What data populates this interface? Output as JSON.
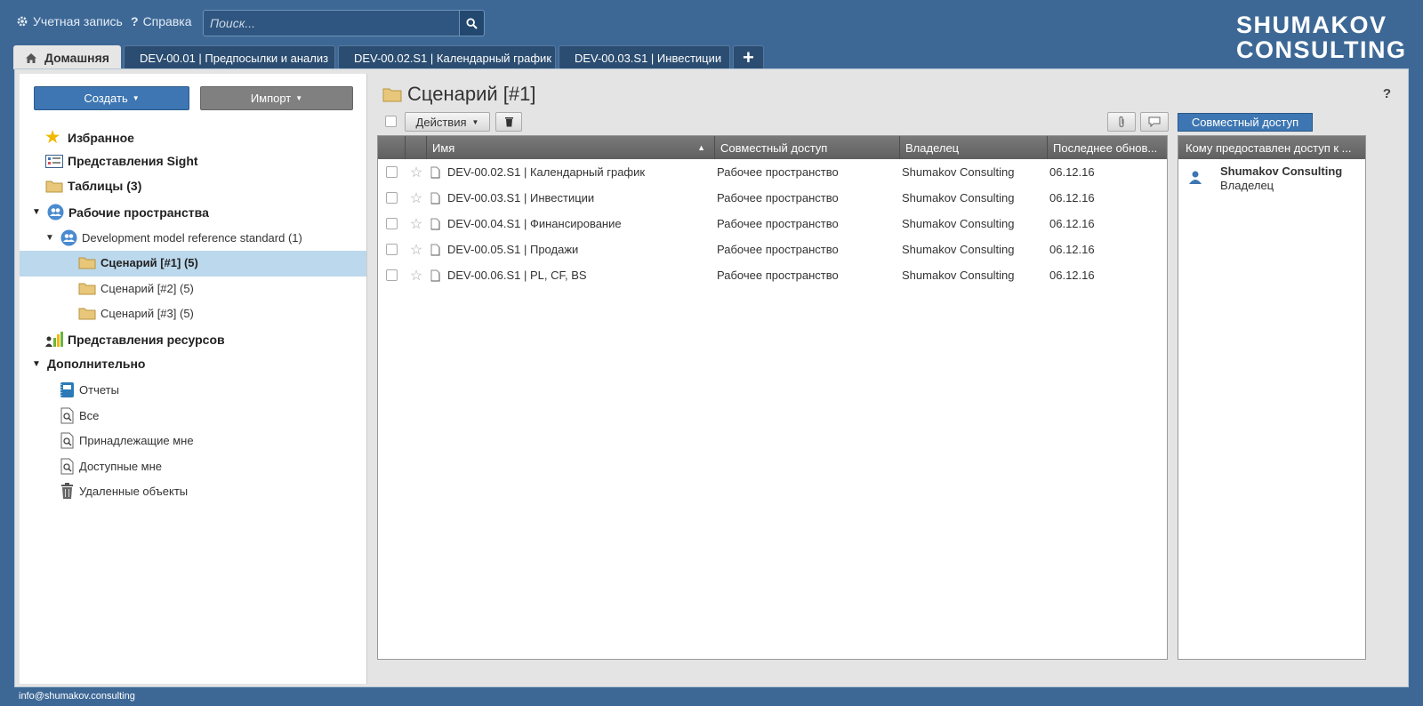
{
  "topbar": {
    "account_label": "Учетная запись",
    "help_label": "Справка",
    "search_placeholder": "Поиск..."
  },
  "logo": {
    "line1": "SHUMAKOV",
    "line2": "CONSULTING"
  },
  "tabs": [
    {
      "label": "Домашняя",
      "active": true
    },
    {
      "label": "DEV-00.01 | Предпосылки и анализ"
    },
    {
      "label": "DEV-00.02.S1 | Календарный график"
    },
    {
      "label": "DEV-00.03.S1 | Инвестиции"
    }
  ],
  "sidebar": {
    "create_label": "Создать",
    "import_label": "Импорт",
    "favorites": "Избранное",
    "sight_views": "Представления Sight",
    "tables": "Таблицы (3)",
    "workspaces": "Рабочие пространства",
    "workspace_item": "Development model reference standard (1)",
    "scenarios": [
      "Сценарий [#1] (5)",
      "Сценарий [#2] (5)",
      "Сценарий [#3] (5)"
    ],
    "resource_views": "Представления ресурсов",
    "additional": "Дополнительно",
    "additional_items": [
      "Отчеты",
      "Все",
      "Принадлежащие мне",
      "Доступные мне",
      "Удаленные объекты"
    ]
  },
  "main": {
    "title": "Сценарий [#1]",
    "help": "?",
    "actions_label": "Действия",
    "share_button": "Совместный доступ"
  },
  "grid": {
    "columns": [
      "Имя",
      "Совместный доступ",
      "Владелец",
      "Последнее обнов..."
    ],
    "rows": [
      {
        "name": "DEV-00.02.S1 | Календарный график",
        "share": "Рабочее пространство",
        "owner": "Shumakov Consulting",
        "date": "06.12.16"
      },
      {
        "name": "DEV-00.03.S1 | Инвестиции",
        "share": "Рабочее пространство",
        "owner": "Shumakov Consulting",
        "date": "06.12.16"
      },
      {
        "name": "DEV-00.04.S1 | Финансирование",
        "share": "Рабочее пространство",
        "owner": "Shumakov Consulting",
        "date": "06.12.16"
      },
      {
        "name": "DEV-00.05.S1 | Продажи",
        "share": "Рабочее пространство",
        "owner": "Shumakov Consulting",
        "date": "06.12.16"
      },
      {
        "name": "DEV-00.06.S1 | PL, CF, BS",
        "share": "Рабочее пространство",
        "owner": "Shumakov Consulting",
        "date": "06.12.16"
      }
    ]
  },
  "share_panel": {
    "header": "Кому предоставлен доступ к ...",
    "user_name": "Shumakov Consulting",
    "user_role": "Владелец"
  },
  "footer": {
    "email": "info@shumakov.consulting"
  }
}
